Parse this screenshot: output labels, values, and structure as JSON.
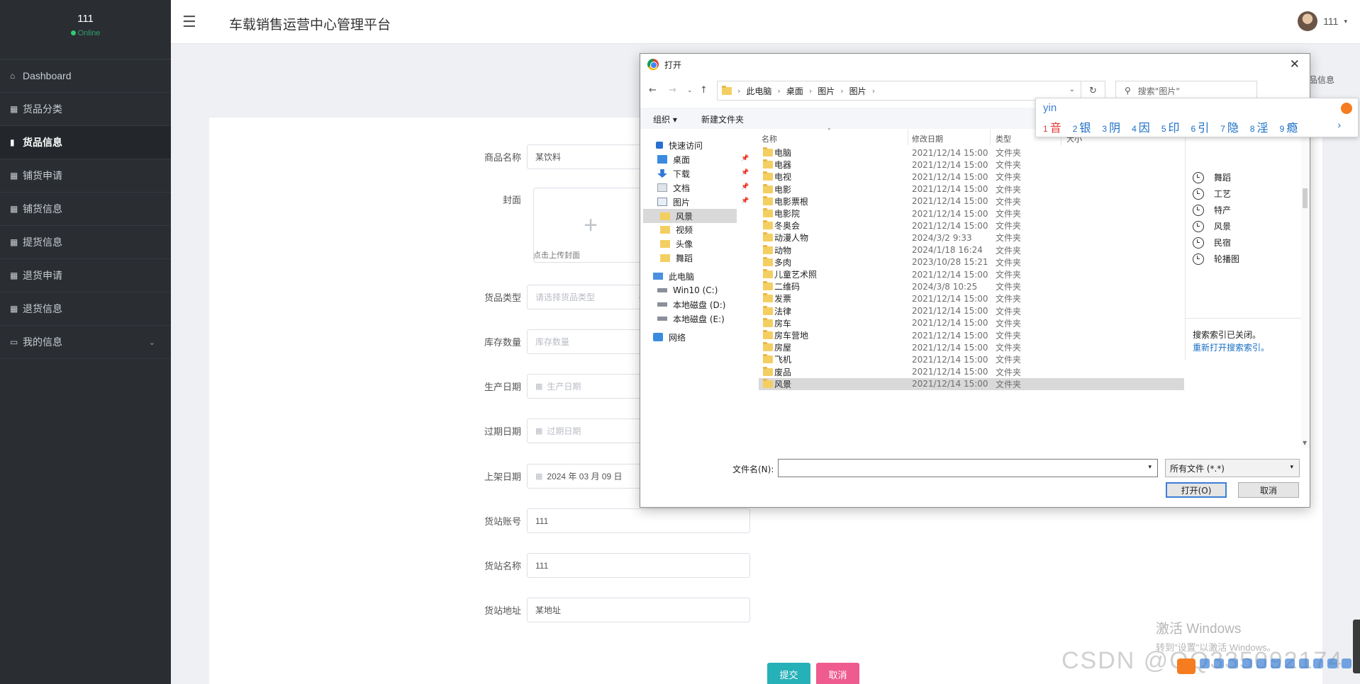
{
  "sidebar": {
    "user_name": "111",
    "status": "Online",
    "items": [
      {
        "label": "Dashboard",
        "icon": "home-icon"
      },
      {
        "label": "货品分类",
        "icon": "grid-icon"
      },
      {
        "label": "货品信息",
        "icon": "file-icon"
      },
      {
        "label": "铺货申请",
        "icon": "grid-icon"
      },
      {
        "label": "铺货信息",
        "icon": "grid-icon"
      },
      {
        "label": "提货信息",
        "icon": "grid-icon"
      },
      {
        "label": "退货申请",
        "icon": "grid-icon"
      },
      {
        "label": "退货信息",
        "icon": "grid-icon"
      },
      {
        "label": "我的信息",
        "icon": "card-icon"
      }
    ],
    "active_index": 2
  },
  "header": {
    "title": "车载销售运营中心管理平台",
    "user": "111"
  },
  "background_partial_text": "品信息",
  "form": {
    "name_label": "商品名称",
    "name_value": "某饮料",
    "cover_label": "封面",
    "cover_tip": "点击上传封面",
    "type_label": "货品类型",
    "type_placeholder": "请选择货品类型",
    "stock_label": "库存数量",
    "stock_placeholder": "库存数量",
    "prod_date_label": "生产日期",
    "prod_date_placeholder": "生产日期",
    "exp_date_label": "过期日期",
    "exp_date_placeholder": "过期日期",
    "shelf_date_label": "上架日期",
    "shelf_date_value": "2024 年 03 月 09 日",
    "station_account_label": "货站账号",
    "station_account_value": "111",
    "station_name_label": "货站名称",
    "station_name_value": "111",
    "station_addr_label": "货站地址",
    "station_addr_value": "某地址",
    "submit": "提交",
    "cancel": "取消"
  },
  "dialog": {
    "title": "打开",
    "crumbs": [
      "此电脑",
      "桌面",
      "图片",
      "图片"
    ],
    "search_placeholder": "搜索\"图片\"",
    "toolbar": {
      "organize": "组织 ▾",
      "new_folder": "新建文件夹"
    },
    "tree": [
      {
        "label": "快速访问",
        "icon": "star-icon"
      },
      {
        "label": "桌面",
        "icon": "desktop-icon",
        "pinned": true
      },
      {
        "label": "下载",
        "icon": "download-icon",
        "pinned": true
      },
      {
        "label": "文档",
        "icon": "document-icon",
        "pinned": true
      },
      {
        "label": "图片",
        "icon": "picture-icon",
        "pinned": true
      },
      {
        "label": "风景",
        "icon": "folder-icon"
      },
      {
        "label": "视频",
        "icon": "folder-icon"
      },
      {
        "label": "头像",
        "icon": "folder-icon"
      },
      {
        "label": "舞蹈",
        "icon": "folder-icon"
      },
      {
        "label": "此电脑",
        "icon": "computer-icon"
      },
      {
        "label": "Win10 (C:)",
        "icon": "drive-icon"
      },
      {
        "label": "本地磁盘 (D:)",
        "icon": "drive-icon"
      },
      {
        "label": "本地磁盘 (E:)",
        "icon": "drive-icon"
      },
      {
        "label": "网络",
        "icon": "network-icon"
      }
    ],
    "columns": {
      "name": "名称",
      "date": "修改日期",
      "type": "类型",
      "size": "大小"
    },
    "files": [
      {
        "name": "电脑",
        "date": "2021/12/14 15:00",
        "type": "文件夹"
      },
      {
        "name": "电器",
        "date": "2021/12/14 15:00",
        "type": "文件夹"
      },
      {
        "name": "电视",
        "date": "2021/12/14 15:00",
        "type": "文件夹"
      },
      {
        "name": "电影",
        "date": "2021/12/14 15:00",
        "type": "文件夹"
      },
      {
        "name": "电影票根",
        "date": "2021/12/14 15:00",
        "type": "文件夹"
      },
      {
        "name": "电影院",
        "date": "2021/12/14 15:00",
        "type": "文件夹"
      },
      {
        "name": "冬奥会",
        "date": "2021/12/14 15:00",
        "type": "文件夹"
      },
      {
        "name": "动漫人物",
        "date": "2024/3/2 9:33",
        "type": "文件夹"
      },
      {
        "name": "动物",
        "date": "2024/1/18 16:24",
        "type": "文件夹"
      },
      {
        "name": "多肉",
        "date": "2023/10/28 15:21",
        "type": "文件夹"
      },
      {
        "name": "儿童艺术照",
        "date": "2021/12/14 15:00",
        "type": "文件夹"
      },
      {
        "name": "二维码",
        "date": "2024/3/8 10:25",
        "type": "文件夹"
      },
      {
        "name": "发票",
        "date": "2021/12/14 15:00",
        "type": "文件夹"
      },
      {
        "name": "法律",
        "date": "2021/12/14 15:00",
        "type": "文件夹"
      },
      {
        "name": "房车",
        "date": "2021/12/14 15:00",
        "type": "文件夹"
      },
      {
        "name": "房车营地",
        "date": "2021/12/14 15:00",
        "type": "文件夹"
      },
      {
        "name": "房屋",
        "date": "2021/12/14 15:00",
        "type": "文件夹"
      },
      {
        "name": "飞机",
        "date": "2021/12/14 15:00",
        "type": "文件夹"
      },
      {
        "name": "废品",
        "date": "2021/12/14 15:00",
        "type": "文件夹"
      },
      {
        "name": "风景",
        "date": "2021/12/14 15:00",
        "type": "文件夹"
      }
    ],
    "selected_file_index": 19,
    "search_history": [
      "舞蹈",
      "工艺",
      "特产",
      "风景",
      "民宿",
      "轮播图"
    ],
    "index_note": "搜索索引已关闭。",
    "index_link": "重新打开搜索索引。",
    "filename_label": "文件名(N):",
    "filename_value": "",
    "filetype": "所有文件 (*.*)",
    "open_button": "打开(O)",
    "cancel_button": "取消"
  },
  "ime": {
    "input": "yin",
    "candidates": [
      {
        "n": "1",
        "c": "音"
      },
      {
        "n": "2",
        "c": "银"
      },
      {
        "n": "3",
        "c": "阴"
      },
      {
        "n": "4",
        "c": "因"
      },
      {
        "n": "5",
        "c": "印"
      },
      {
        "n": "6",
        "c": "引"
      },
      {
        "n": "7",
        "c": "隐"
      },
      {
        "n": "8",
        "c": "淫"
      },
      {
        "n": "9",
        "c": "瘾"
      }
    ]
  },
  "watermark": {
    "activate_title": "激活 Windows",
    "activate_sub": "转到\"设置\"以激活 Windows。",
    "csdn": "CSDN @QQ335092174"
  }
}
